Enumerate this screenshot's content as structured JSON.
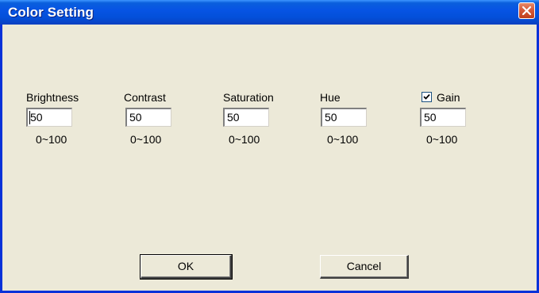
{
  "window": {
    "title": "Color Setting"
  },
  "fields": [
    {
      "label": "Brightness",
      "value": "50",
      "range": "0~100"
    },
    {
      "label": "Contrast",
      "value": "50",
      "range": "0~100"
    },
    {
      "label": "Saturation",
      "value": "50",
      "range": "0~100"
    },
    {
      "label": "Hue",
      "value": "50",
      "range": "0~100"
    },
    {
      "label": "Gain",
      "value": "50",
      "range": "0~100",
      "checked": true
    }
  ],
  "buttons": {
    "ok": "OK",
    "cancel": "Cancel"
  },
  "icons": {
    "close": "close-icon",
    "check": "checkmark-icon"
  },
  "colors": {
    "titlebar": "#0754e4",
    "close_button": "#d65a3a",
    "dialog_background": "#ece9d8"
  }
}
